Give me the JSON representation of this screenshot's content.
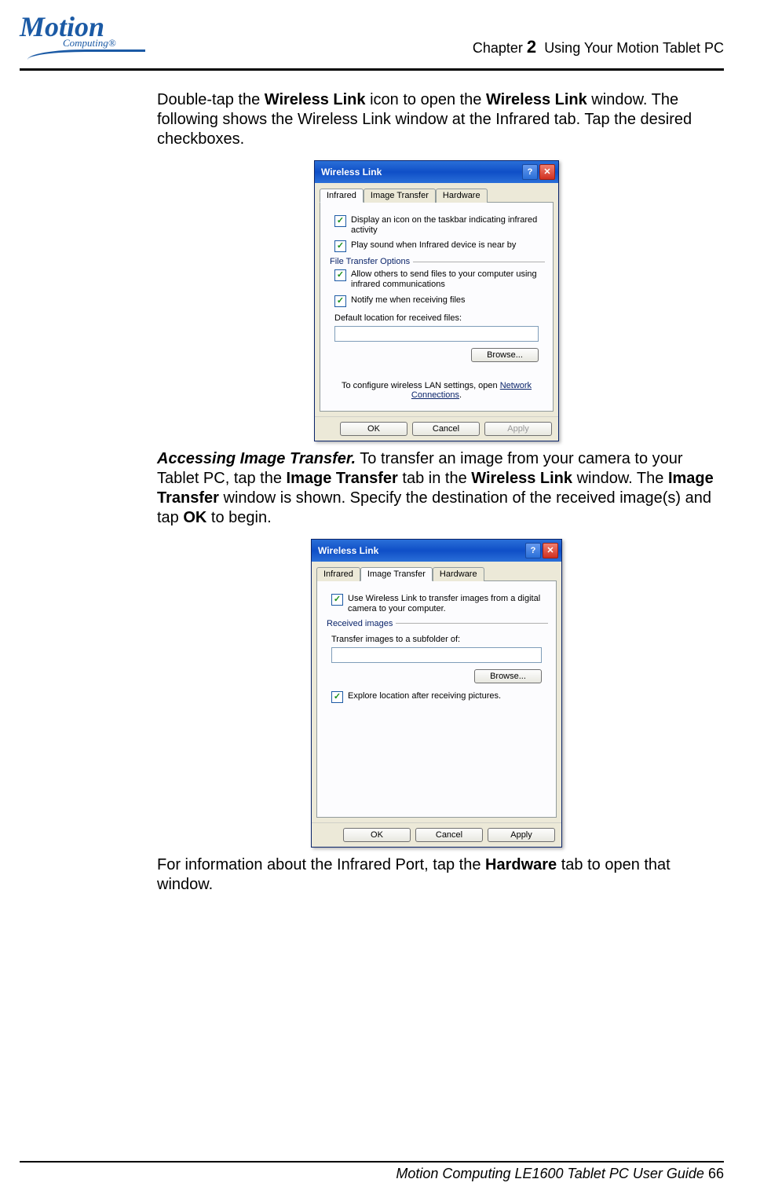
{
  "header": {
    "logo_main": "Motion",
    "logo_sub": "Computing®",
    "chapter_label": "Chapter",
    "chapter_num": "2",
    "chapter_title": "Using Your Motion Tablet PC"
  },
  "para1": {
    "pre1": "Double-tap the ",
    "b1": "Wireless Link",
    "mid1": " icon to open the ",
    "b2": "Wireless Link",
    "post1": " window. The following shows the Wireless Link window at the Infrared tab. Tap the desired checkboxes."
  },
  "dialog1": {
    "title": "Wireless Link",
    "tabs": [
      "Infrared",
      "Image Transfer",
      "Hardware"
    ],
    "active_tab": 0,
    "chk1": "Display an icon on the taskbar indicating infrared activity",
    "chk2": "Play sound when Infrared device is near by",
    "group": "File Transfer Options",
    "chk3": "Allow others to send files to your computer using infrared communications",
    "chk4": "Notify me when receiving files",
    "loc_label": "Default location for received files:",
    "browse": "Browse...",
    "note_pre": "To configure wireless LAN settings, open ",
    "note_link": "Network Connections",
    "ok": "OK",
    "cancel": "Cancel",
    "apply": "Apply"
  },
  "para2": {
    "ib": "Accessing Image Transfer.",
    "t1": "  To transfer an image from your camera to your Tablet PC, tap the ",
    "b1": "Image Transfer",
    "t2": " tab in the ",
    "b2": "Wireless Link",
    "t3": " window. The ",
    "b3": "Image Transfer",
    "t4": " window is shown. Specify the destination of the received image(s) and tap ",
    "b4": "OK",
    "t5": " to begin."
  },
  "dialog2": {
    "title": "Wireless Link",
    "tabs": [
      "Infrared",
      "Image Transfer",
      "Hardware"
    ],
    "active_tab": 1,
    "chk1": "Use Wireless Link to transfer images from a digital camera to your computer.",
    "group": "Received images",
    "loc_label": "Transfer images to a subfolder of:",
    "browse": "Browse...",
    "chk2": "Explore location after receiving pictures.",
    "ok": "OK",
    "cancel": "Cancel",
    "apply": "Apply"
  },
  "para3": {
    "t1": "For information about the Infrared Port, tap the ",
    "b1": "Hardware",
    "t2": " tab to open that window."
  },
  "footer": {
    "text": "Motion Computing LE1600 Tablet PC User Guide",
    "page": "66"
  }
}
